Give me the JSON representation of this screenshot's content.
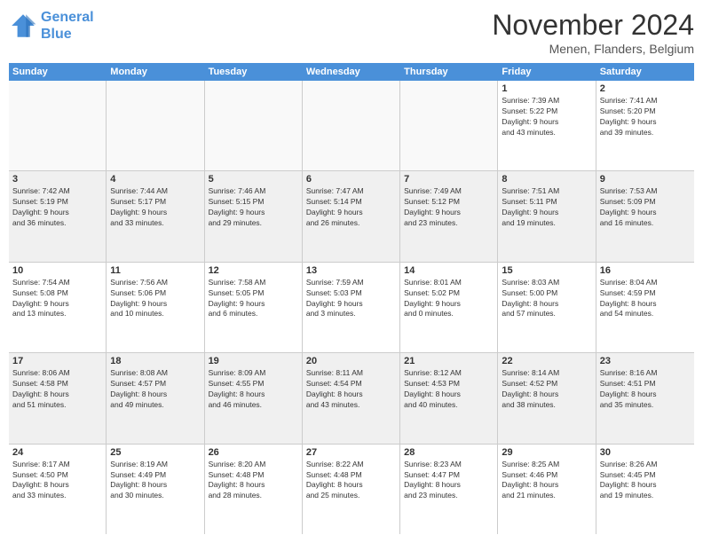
{
  "logo": {
    "line1": "General",
    "line2": "Blue"
  },
  "title": "November 2024",
  "subtitle": "Menen, Flanders, Belgium",
  "header_days": [
    "Sunday",
    "Monday",
    "Tuesday",
    "Wednesday",
    "Thursday",
    "Friday",
    "Saturday"
  ],
  "weeks": [
    [
      {
        "day": "",
        "info": ""
      },
      {
        "day": "",
        "info": ""
      },
      {
        "day": "",
        "info": ""
      },
      {
        "day": "",
        "info": ""
      },
      {
        "day": "",
        "info": ""
      },
      {
        "day": "1",
        "info": "Sunrise: 7:39 AM\nSunset: 5:22 PM\nDaylight: 9 hours\nand 43 minutes."
      },
      {
        "day": "2",
        "info": "Sunrise: 7:41 AM\nSunset: 5:20 PM\nDaylight: 9 hours\nand 39 minutes."
      }
    ],
    [
      {
        "day": "3",
        "info": "Sunrise: 7:42 AM\nSunset: 5:19 PM\nDaylight: 9 hours\nand 36 minutes."
      },
      {
        "day": "4",
        "info": "Sunrise: 7:44 AM\nSunset: 5:17 PM\nDaylight: 9 hours\nand 33 minutes."
      },
      {
        "day": "5",
        "info": "Sunrise: 7:46 AM\nSunset: 5:15 PM\nDaylight: 9 hours\nand 29 minutes."
      },
      {
        "day": "6",
        "info": "Sunrise: 7:47 AM\nSunset: 5:14 PM\nDaylight: 9 hours\nand 26 minutes."
      },
      {
        "day": "7",
        "info": "Sunrise: 7:49 AM\nSunset: 5:12 PM\nDaylight: 9 hours\nand 23 minutes."
      },
      {
        "day": "8",
        "info": "Sunrise: 7:51 AM\nSunset: 5:11 PM\nDaylight: 9 hours\nand 19 minutes."
      },
      {
        "day": "9",
        "info": "Sunrise: 7:53 AM\nSunset: 5:09 PM\nDaylight: 9 hours\nand 16 minutes."
      }
    ],
    [
      {
        "day": "10",
        "info": "Sunrise: 7:54 AM\nSunset: 5:08 PM\nDaylight: 9 hours\nand 13 minutes."
      },
      {
        "day": "11",
        "info": "Sunrise: 7:56 AM\nSunset: 5:06 PM\nDaylight: 9 hours\nand 10 minutes."
      },
      {
        "day": "12",
        "info": "Sunrise: 7:58 AM\nSunset: 5:05 PM\nDaylight: 9 hours\nand 6 minutes."
      },
      {
        "day": "13",
        "info": "Sunrise: 7:59 AM\nSunset: 5:03 PM\nDaylight: 9 hours\nand 3 minutes."
      },
      {
        "day": "14",
        "info": "Sunrise: 8:01 AM\nSunset: 5:02 PM\nDaylight: 9 hours\nand 0 minutes."
      },
      {
        "day": "15",
        "info": "Sunrise: 8:03 AM\nSunset: 5:00 PM\nDaylight: 8 hours\nand 57 minutes."
      },
      {
        "day": "16",
        "info": "Sunrise: 8:04 AM\nSunset: 4:59 PM\nDaylight: 8 hours\nand 54 minutes."
      }
    ],
    [
      {
        "day": "17",
        "info": "Sunrise: 8:06 AM\nSunset: 4:58 PM\nDaylight: 8 hours\nand 51 minutes."
      },
      {
        "day": "18",
        "info": "Sunrise: 8:08 AM\nSunset: 4:57 PM\nDaylight: 8 hours\nand 49 minutes."
      },
      {
        "day": "19",
        "info": "Sunrise: 8:09 AM\nSunset: 4:55 PM\nDaylight: 8 hours\nand 46 minutes."
      },
      {
        "day": "20",
        "info": "Sunrise: 8:11 AM\nSunset: 4:54 PM\nDaylight: 8 hours\nand 43 minutes."
      },
      {
        "day": "21",
        "info": "Sunrise: 8:12 AM\nSunset: 4:53 PM\nDaylight: 8 hours\nand 40 minutes."
      },
      {
        "day": "22",
        "info": "Sunrise: 8:14 AM\nSunset: 4:52 PM\nDaylight: 8 hours\nand 38 minutes."
      },
      {
        "day": "23",
        "info": "Sunrise: 8:16 AM\nSunset: 4:51 PM\nDaylight: 8 hours\nand 35 minutes."
      }
    ],
    [
      {
        "day": "24",
        "info": "Sunrise: 8:17 AM\nSunset: 4:50 PM\nDaylight: 8 hours\nand 33 minutes."
      },
      {
        "day": "25",
        "info": "Sunrise: 8:19 AM\nSunset: 4:49 PM\nDaylight: 8 hours\nand 30 minutes."
      },
      {
        "day": "26",
        "info": "Sunrise: 8:20 AM\nSunset: 4:48 PM\nDaylight: 8 hours\nand 28 minutes."
      },
      {
        "day": "27",
        "info": "Sunrise: 8:22 AM\nSunset: 4:48 PM\nDaylight: 8 hours\nand 25 minutes."
      },
      {
        "day": "28",
        "info": "Sunrise: 8:23 AM\nSunset: 4:47 PM\nDaylight: 8 hours\nand 23 minutes."
      },
      {
        "day": "29",
        "info": "Sunrise: 8:25 AM\nSunset: 4:46 PM\nDaylight: 8 hours\nand 21 minutes."
      },
      {
        "day": "30",
        "info": "Sunrise: 8:26 AM\nSunset: 4:45 PM\nDaylight: 8 hours\nand 19 minutes."
      }
    ]
  ]
}
